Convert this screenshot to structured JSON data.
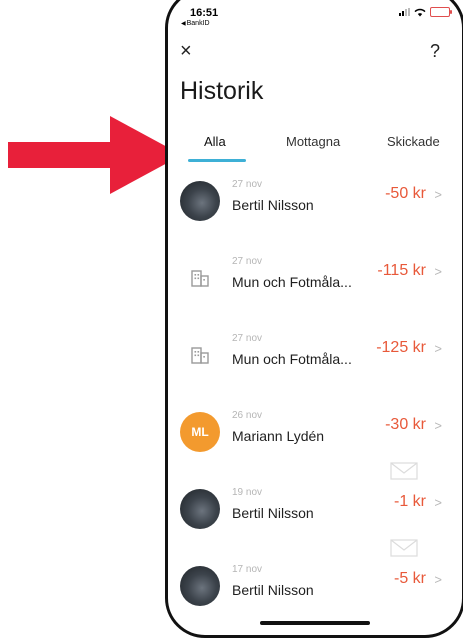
{
  "status_bar": {
    "time": "16:51",
    "back_app": "BankID"
  },
  "header": {
    "close_symbol": "×",
    "help_symbol": "?",
    "title": "Historik"
  },
  "tabs": [
    {
      "label": "Alla",
      "active": true
    },
    {
      "label": "Mottagna",
      "active": false
    },
    {
      "label": "Skickade",
      "active": false
    }
  ],
  "transactions": [
    {
      "date": "27 nov",
      "name": "Bertil Nilsson",
      "amount": "-50 kr",
      "avatar": "photo",
      "has_message": false
    },
    {
      "date": "27 nov",
      "name": "Mun och Fotmåla...",
      "amount": "-115 kr",
      "avatar": "building-icon",
      "has_message": false
    },
    {
      "date": "27 nov",
      "name": "Mun och Fotmåla...",
      "amount": "-125 kr",
      "avatar": "building-icon",
      "has_message": false
    },
    {
      "date": "26 nov",
      "name": "Mariann Lydén",
      "amount": "-30 kr",
      "avatar": "initials",
      "initials": "ML",
      "has_message": true
    },
    {
      "date": "19 nov",
      "name": "Bertil Nilsson",
      "amount": "-1 kr",
      "avatar": "photo",
      "has_message": true
    },
    {
      "date": "17 nov",
      "name": "Bertil Nilsson",
      "amount": "-5 kr",
      "avatar": "photo",
      "has_message": false
    }
  ],
  "colors": {
    "accent": "#3eb0d6",
    "amount": "#e8593a",
    "annotation_arrow": "#e8203a",
    "initials_avatar": "#f39a2e"
  }
}
